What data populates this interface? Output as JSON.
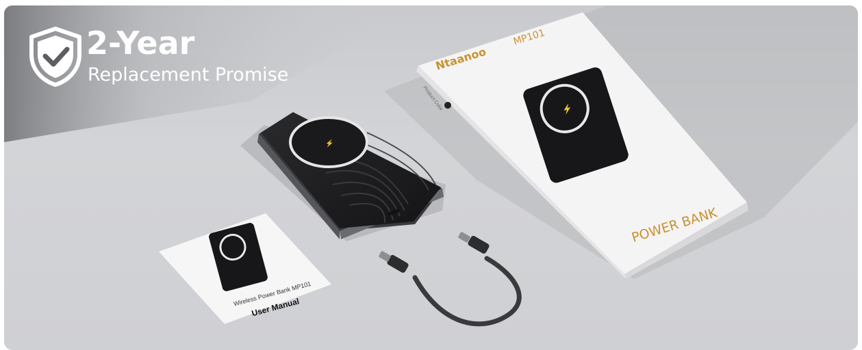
{
  "banner": {
    "headline": "2-Year",
    "subline": "Replacement Promise",
    "badge_icon": "shield-check-icon"
  },
  "box": {
    "brand": "Ntaanoo",
    "model": "MP101",
    "label": "POWER BANK"
  },
  "manual": {
    "subtitle": "Wireless Power Bank MP101",
    "title": "User Manual"
  },
  "colors": {
    "accent_gold": "#c9922f",
    "background": "#cfd0d3",
    "device": "#1c1c1e"
  }
}
